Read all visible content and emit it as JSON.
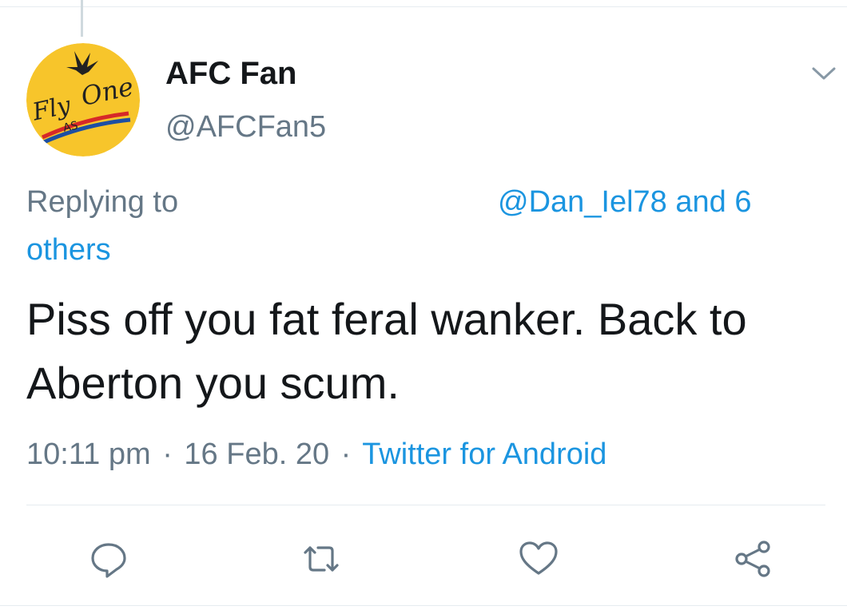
{
  "author": {
    "display_name": "AFC Fan",
    "handle": "@AFCFan5",
    "avatar_text": "Fly As One"
  },
  "reply": {
    "prefix": "Replying to",
    "mentions": "@Dan_Iel78 and 6",
    "others": "others"
  },
  "tweet": {
    "text": "Piss off you fat feral wanker. Back to Aberton you scum."
  },
  "meta": {
    "time": "10:11 pm",
    "separator": "·",
    "date": "16 Feb. 20",
    "source": "Twitter for Android"
  },
  "icons": {
    "more": "chevron-down-icon",
    "reply": "reply-icon",
    "retweet": "retweet-icon",
    "like": "heart-icon",
    "share": "share-icon"
  },
  "colors": {
    "link": "#1b95e0",
    "secondary": "#657786",
    "avatar_bg": "#f7c52b"
  }
}
